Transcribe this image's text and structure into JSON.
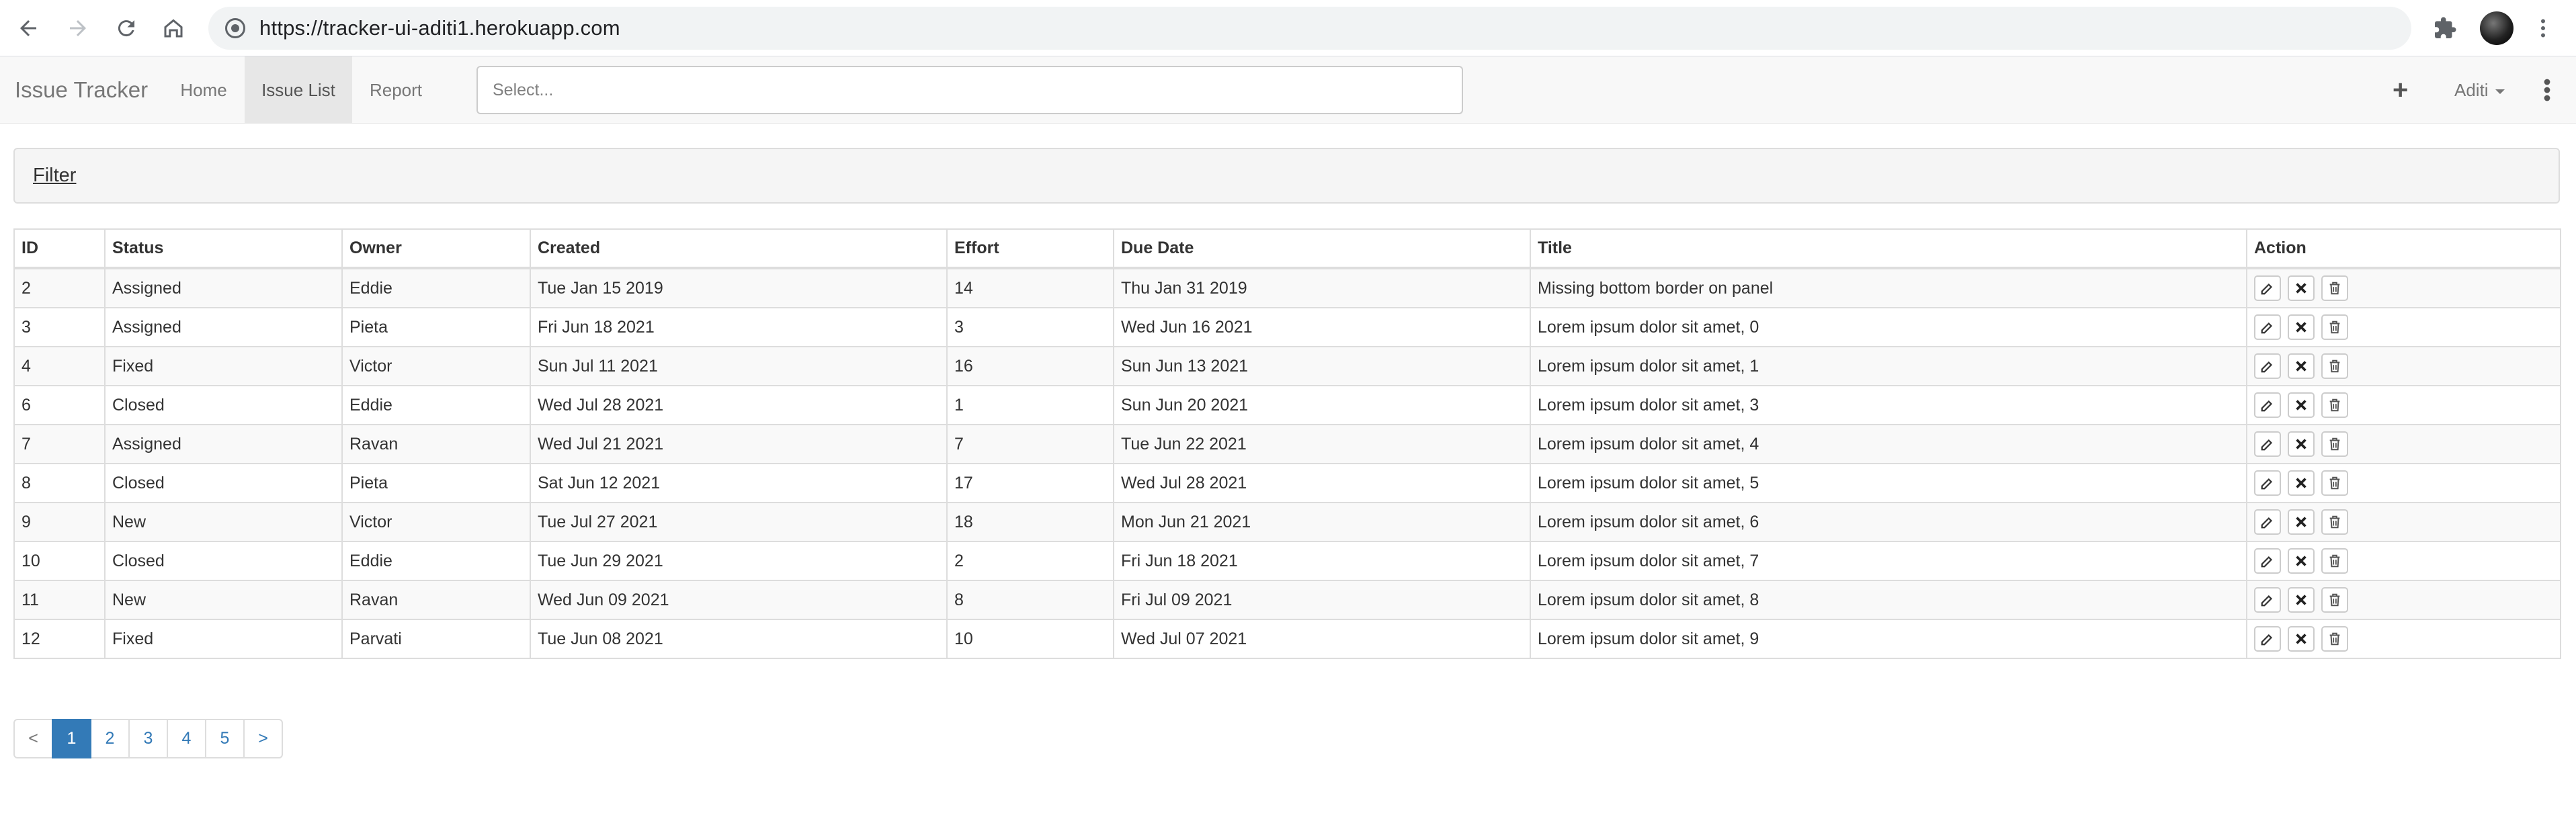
{
  "browser": {
    "url": "https://tracker-ui-aditi1.herokuapp.com"
  },
  "navbar": {
    "brand": "Issue Tracker",
    "links": [
      "Home",
      "Issue List",
      "Report"
    ],
    "active_link": "Issue List",
    "select_placeholder": "Select...",
    "add_icon": "+",
    "user": "Aditi"
  },
  "filter": {
    "label": "Filter"
  },
  "table": {
    "headers": [
      "ID",
      "Status",
      "Owner",
      "Created",
      "Effort",
      "Due Date",
      "Title",
      "Action"
    ],
    "rows": [
      [
        "2",
        "Assigned",
        "Eddie",
        "Tue Jan 15 2019",
        "14",
        "Thu Jan 31 2019",
        "Missing bottom border on panel"
      ],
      [
        "3",
        "Assigned",
        "Pieta",
        "Fri Jun 18 2021",
        "3",
        "Wed Jun 16 2021",
        "Lorem ipsum dolor sit amet, 0"
      ],
      [
        "4",
        "Fixed",
        "Victor",
        "Sun Jul 11 2021",
        "16",
        "Sun Jun 13 2021",
        "Lorem ipsum dolor sit amet, 1"
      ],
      [
        "6",
        "Closed",
        "Eddie",
        "Wed Jul 28 2021",
        "1",
        "Sun Jun 20 2021",
        "Lorem ipsum dolor sit amet, 3"
      ],
      [
        "7",
        "Assigned",
        "Ravan",
        "Wed Jul 21 2021",
        "7",
        "Tue Jun 22 2021",
        "Lorem ipsum dolor sit amet, 4"
      ],
      [
        "8",
        "Closed",
        "Pieta",
        "Sat Jun 12 2021",
        "17",
        "Wed Jul 28 2021",
        "Lorem ipsum dolor sit amet, 5"
      ],
      [
        "9",
        "New",
        "Victor",
        "Tue Jul 27 2021",
        "18",
        "Mon Jun 21 2021",
        "Lorem ipsum dolor sit amet, 6"
      ],
      [
        "10",
        "Closed",
        "Eddie",
        "Tue Jun 29 2021",
        "2",
        "Fri Jun 18 2021",
        "Lorem ipsum dolor sit amet, 7"
      ],
      [
        "11",
        "New",
        "Ravan",
        "Wed Jun 09 2021",
        "8",
        "Fri Jul 09 2021",
        "Lorem ipsum dolor sit amet, 8"
      ],
      [
        "12",
        "Fixed",
        "Parvati",
        "Tue Jun 08 2021",
        "10",
        "Wed Jul 07 2021",
        "Lorem ipsum dolor sit amet, 9"
      ]
    ],
    "row_actions": [
      "edit-icon",
      "close-icon",
      "trash-icon"
    ]
  },
  "pagination": {
    "prev": "<",
    "pages": [
      "1",
      "2",
      "3",
      "4",
      "5"
    ],
    "active_page": "1",
    "next": ">"
  },
  "colors": {
    "link": "#337ab7",
    "navbar_bg": "#f8f8f8",
    "active_tab_bg": "#e7e7e7",
    "border": "#dddddd"
  }
}
